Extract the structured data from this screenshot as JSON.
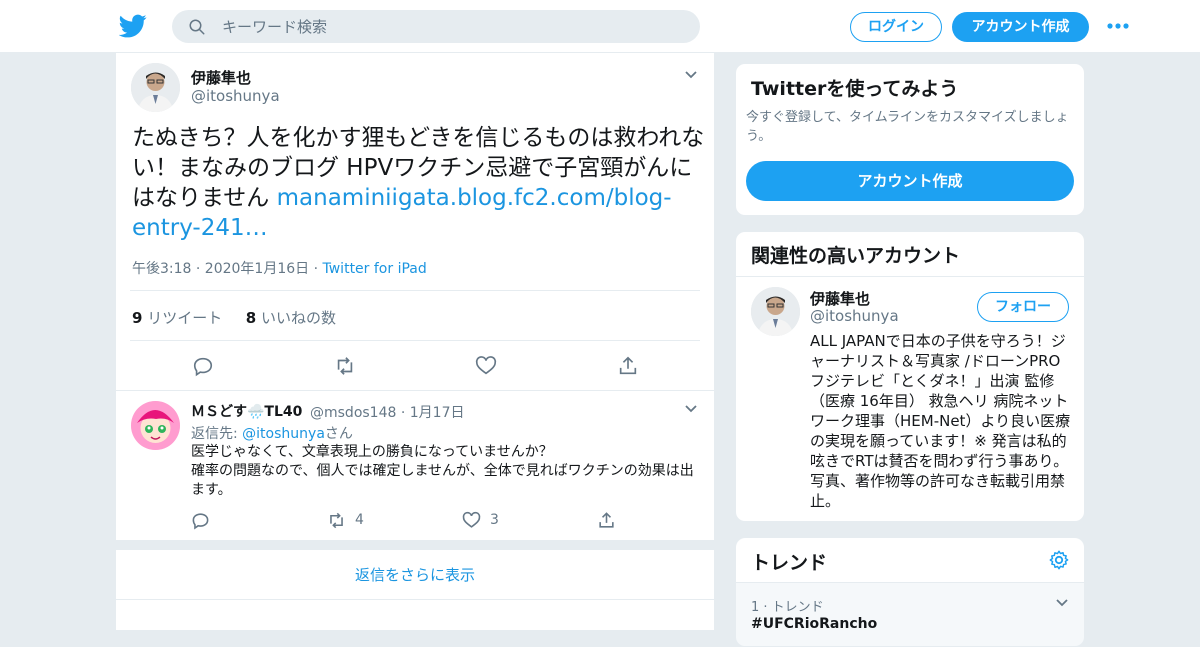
{
  "header": {
    "search_placeholder": "キーワード検索",
    "login_label": "ログイン",
    "signup_label": "アカウント作成"
  },
  "tweet": {
    "author_name": "伊藤隼也",
    "author_handle": "@itoshunya",
    "text": "たぬきち？人を化かす狸もどきを信じるものは救われない！まなみのブログ HPVワクチン忌避で子宮頸がんにはなりません ",
    "link": "manaminiigata.blog.fc2.com/blog-entry-241…",
    "timestamp": "午後3:18 · 2020年1月16日",
    "separator": " · ",
    "source": "Twitter for iPad",
    "retweet_count": "9",
    "retweet_label": "リツイート",
    "like_count": "8",
    "like_label": "いいねの数"
  },
  "reply": {
    "author_name": "ＭＳどす🌧️TL40",
    "author_handle": "@msdos148 · 1月17日",
    "reply_to_prefix": "返信先: ",
    "reply_to_handle": "@itoshunya",
    "reply_to_suffix": "さん",
    "text_line1": "医学じゃなくて、文章表現上の勝負になっていませんか？",
    "text_line2": "確率の問題なので、個人では確定しませんが、全体で見ればワクチンの効果は出ます。",
    "retweet_count": "4",
    "like_count": "3"
  },
  "show_more_replies": "返信をさらに表示",
  "sidebar": {
    "signup_card": {
      "title": "Twitterを使ってみよう",
      "subtitle": "今すぐ登録して、タイムラインをカスタマイズしましょう。",
      "button": "アカウント作成"
    },
    "related": {
      "title": "関連性の高いアカウント",
      "name": "伊藤隼也",
      "handle": "@itoshunya",
      "follow_label": "フォロー",
      "bio": "ALL JAPANで日本の子供を守ろう！ジャーナリスト＆写真家 /ドローンPRO フジテレビ「とくダネ！」出演 監修（医療 16年目） 救急ヘリ 病院ネットワーク理事（HEM-Net）より良い医療の実現を願っています！※ 発言は私的呟きでRTは賛否を問わず行う事あり。写真、著作物等の許可なき転載引用禁止。"
    },
    "trends": {
      "title": "トレンド",
      "items": [
        {
          "meta": "1 · トレンド",
          "name": "#UFCRioRancho"
        }
      ]
    }
  },
  "colors": {
    "accent": "#1da1f2",
    "link": "#1b95e0",
    "muted": "#657786",
    "background": "#e6ecf0"
  }
}
